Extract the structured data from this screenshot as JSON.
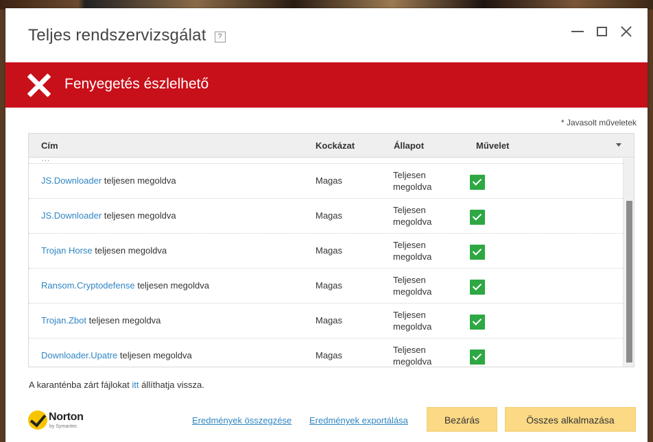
{
  "window": {
    "title": "Teljes rendszervizsgálat",
    "help_glyph": "?"
  },
  "alert": {
    "text": "Fenyegetés észlelhető",
    "color": "#c8101a"
  },
  "table": {
    "recommended_note": "* Javasolt műveletek",
    "headers": {
      "title": "Cím",
      "risk": "Kockázat",
      "status": "Állapot",
      "action": "Művelet"
    },
    "rows": [
      {
        "threat": "JS.Downloader",
        "suffix": "teljesen megoldva",
        "risk": "Magas",
        "status_line1": "Teljesen",
        "status_line2": "megoldva",
        "checked": true
      },
      {
        "threat": "JS.Downloader",
        "suffix": "teljesen megoldva",
        "risk": "Magas",
        "status_line1": "Teljesen",
        "status_line2": "megoldva",
        "checked": true
      },
      {
        "threat": "Trojan Horse",
        "suffix": "teljesen megoldva",
        "risk": "Magas",
        "status_line1": "Teljesen",
        "status_line2": "megoldva",
        "checked": true
      },
      {
        "threat": "Ransom.Cryptodefense",
        "suffix": "teljesen megoldva",
        "risk": "Magas",
        "status_line1": "Teljesen",
        "status_line2": "megoldva",
        "checked": true
      },
      {
        "threat": "Trojan.Zbot",
        "suffix": "teljesen megoldva",
        "risk": "Magas",
        "status_line1": "Teljesen",
        "status_line2": "megoldva",
        "checked": true
      },
      {
        "threat": "Downloader.Upatre",
        "suffix": "teljesen megoldva",
        "risk": "Magas",
        "status_line1": "Teljesen",
        "status_line2": "megoldva",
        "checked": true
      }
    ]
  },
  "quarantine": {
    "prefix": "A karanténba zárt fájlokat",
    "link": "itt",
    "suffix": "állíthatja vissza."
  },
  "footer": {
    "brand_name": "Norton",
    "brand_sub": "by Symantec",
    "summary_link": "Eredmények összegzése",
    "export_link": "Eredmények exportálása",
    "close_button": "Bezárás",
    "apply_all_button": "Összes alkalmazása"
  },
  "colors": {
    "accent_link": "#2f86c4",
    "button_bg": "#fbd985",
    "check_green": "#2da843"
  }
}
